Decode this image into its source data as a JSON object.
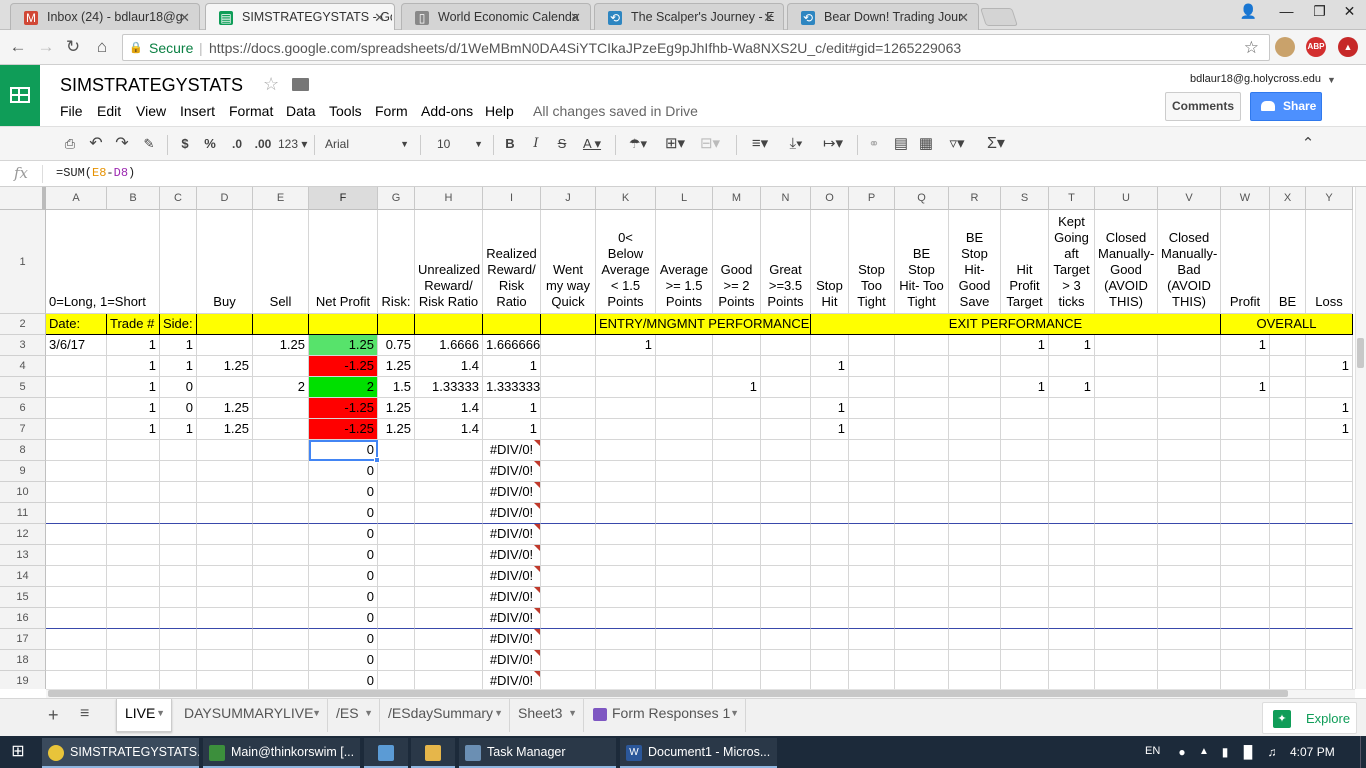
{
  "browser": {
    "tabs": [
      {
        "label": "Inbox (24) - bdlaur18@g",
        "icon": "M",
        "icon_color": "#d14836"
      },
      {
        "label": "SIMSTRATEGYSTATS - Go",
        "icon": "▤",
        "icon_color": "#0f9d58"
      },
      {
        "label": "World Economic Calenda",
        "icon": "▯",
        "icon_color": "#888888"
      },
      {
        "label": "The Scalper's Journey - E",
        "icon": "⟲",
        "icon_color": "#2e86c1"
      },
      {
        "label": "Bear Down! Trading Jour",
        "icon": "⟲",
        "icon_color": "#2e86c1"
      }
    ],
    "close_glyph": "✕",
    "secure_label": "Secure",
    "url": "https://docs.google.com/spreadsheets/d/1WeMBmN0DA4SiYTCIkaJPzeEg9pJhIfhb-Wa8NXS2U_c/edit#gid=1265229063",
    "ext_abp": "ABP"
  },
  "app": {
    "title": "SIMSTRATEGYSTATS",
    "menu": [
      "File",
      "Edit",
      "View",
      "Insert",
      "Format",
      "Data",
      "Tools",
      "Form",
      "Add-ons",
      "Help"
    ],
    "save_status": "All changes saved in Drive",
    "account": "bdlaur18@g.holycross.edu",
    "comments_label": "Comments",
    "share_label": "Share"
  },
  "toolbar": {
    "currency": "$",
    "percent": "%",
    "dec_less": ".0",
    "dec_more": ".00",
    "more_formats": "123",
    "font": "Arial",
    "size": "10",
    "bold": "B",
    "italic": "I",
    "strike": "S",
    "textcolor": "A",
    "sigma": "Σ"
  },
  "formula": {
    "fx": "fx",
    "content": "=SUM(E8-D8)"
  },
  "columns": [
    "A",
    "B",
    "C",
    "D",
    "E",
    "F",
    "G",
    "H",
    "I",
    "J",
    "K",
    "L",
    "M",
    "N",
    "O",
    "P",
    "Q",
    "R",
    "S",
    "T",
    "U",
    "V",
    "W",
    "X",
    "Y"
  ],
  "row_numbers": [
    "1",
    "2",
    "3",
    "4",
    "5",
    "6",
    "7",
    "8",
    "9",
    "10",
    "11",
    "12",
    "13",
    "14",
    "15",
    "16",
    "17",
    "18",
    "19"
  ],
  "header_row": [
    "0=Long, 1=Short",
    "",
    "",
    "Buy",
    "Sell",
    "Net Profit",
    "Risk:",
    "Unrealized Reward/ Risk Ratio",
    "Realized Reward/ Risk Ratio",
    "Went my way Quick",
    "0< Below Average < 1.5 Points",
    "Average >= 1.5 Points",
    "Good >= 2 Points",
    "Great >=3.5 Points",
    "Stop Hit",
    "Stop Too Tight",
    "BE Stop Hit- Too Tight",
    "BE Stop Hit- Good Save",
    "Hit Profit Target",
    "Kept Going aft Target > 3 ticks",
    "Closed Manually-Good (AVOID THIS)",
    "Closed Manually-Bad (AVOID THIS)",
    "Profit",
    "BE",
    "Loss"
  ],
  "section_row": {
    "date": "Date:",
    "trade": "Trade #",
    "side": "Side:",
    "entry": "ENTRY/MNGMNT PERFORMANCE",
    "exit": "EXIT PERFORMANCE",
    "overall": "OVERALL"
  },
  "data_rows": [
    [
      "3/6/17",
      "1",
      "1",
      "",
      "1.25",
      "1.25",
      "0.75",
      "1.6666",
      "1.666666",
      "",
      "1",
      "",
      "",
      "",
      "",
      "",
      "",
      "",
      "1",
      "1",
      "",
      "",
      "1",
      "",
      ""
    ],
    [
      "",
      "1",
      "1",
      "1.25",
      "",
      "-1.25",
      "1.25",
      "1.4",
      "1",
      "",
      "",
      "",
      "",
      "",
      "1",
      "",
      "",
      "",
      "",
      "",
      "",
      "",
      "",
      "",
      "1"
    ],
    [
      "",
      "1",
      "0",
      "",
      "2",
      "2",
      "1.5",
      "1.33333",
      "1.333333",
      "",
      "",
      "",
      "1",
      "",
      "",
      "",
      "",
      "",
      "1",
      "1",
      "",
      "",
      "1",
      "",
      ""
    ],
    [
      "",
      "1",
      "0",
      "1.25",
      "",
      "-1.25",
      "1.25",
      "1.4",
      "1",
      "",
      "",
      "",
      "",
      "",
      "1",
      "",
      "",
      "",
      "",
      "",
      "",
      "",
      "",
      "",
      "1"
    ],
    [
      "",
      "1",
      "1",
      "1.25",
      "",
      "-1.25",
      "1.25",
      "1.4",
      "1",
      "",
      "",
      "",
      "",
      "",
      "1",
      "",
      "",
      "",
      "",
      "",
      "",
      "",
      "",
      "",
      "1"
    ]
  ],
  "empty_row_net_profit": "0",
  "empty_row_ratio": "#DIV/0!",
  "colors": {
    "green": "#57e36b",
    "green_strong": "#00e000",
    "red": "#ff0000",
    "yellow": "#ffff00",
    "sheets_green": "#0f9d58",
    "share_blue": "#4d90fe"
  },
  "sheet_tabs": [
    "LIVE",
    "DAYSUMMARYLIVE",
    "/ES",
    "/ESdaySummary",
    "Sheet3",
    "Form Responses 1"
  ],
  "explore_label": "Explore",
  "taskbar": {
    "items": [
      "SIMSTRATEGYSTATS...",
      "Main@thinkorswim [...",
      "",
      "",
      "Task Manager",
      "Document1 - Micros..."
    ],
    "lang": "EN",
    "clock": "4:07 PM"
  }
}
